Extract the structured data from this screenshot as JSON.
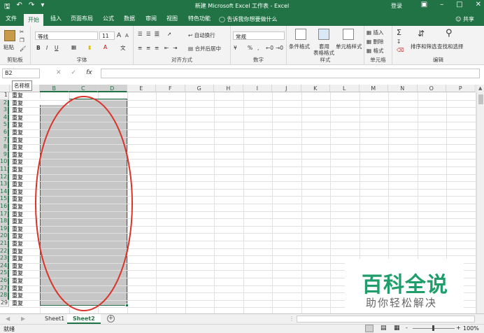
{
  "titlebar": {
    "title": "新建 Microsoft Excel 工作表 - Excel",
    "login": "登录",
    "qat": [
      "save-icon",
      "undo-icon",
      "redo-icon",
      "customize-icon"
    ]
  },
  "tabs": [
    "文件",
    "开始",
    "插入",
    "页面布局",
    "公式",
    "数据",
    "审阅",
    "视图",
    "特色功能"
  ],
  "tell_me": "告诉我你想要做什么",
  "share": "共享",
  "ribbon": {
    "clipboard": {
      "paste": "粘贴",
      "label": "剪贴板"
    },
    "font": {
      "name": "等线",
      "size": "11",
      "bold": "B",
      "italic": "I",
      "underline": "U",
      "grow": "A",
      "shrink": "A",
      "label": "字体"
    },
    "alignment": {
      "wrap": "自动换行",
      "merge": "合并后居中",
      "label": "对齐方式"
    },
    "number": {
      "format": "常规",
      "percent": "%",
      "comma": ",",
      "label": "数字"
    },
    "styles": {
      "conditional": "条件格式",
      "table_1": "套用",
      "table_2": "表格格式",
      "cell_styles": "单元格样式",
      "label": "样式"
    },
    "cells": {
      "insert": "插入",
      "delete": "删除",
      "format": "格式",
      "label": "单元格"
    },
    "editing": {
      "sum": "Σ",
      "sort": "排序和筛选",
      "find": "查找和选择",
      "label": "编辑"
    }
  },
  "formula_bar": {
    "name_box": "B2",
    "fx": "fx",
    "tooltip": "名称框"
  },
  "columns": [
    "A",
    "B",
    "C",
    "D",
    "E",
    "F",
    "G",
    "H",
    "I",
    "J",
    "K",
    "L",
    "M",
    "N",
    "O",
    "P"
  ],
  "selected_columns": [
    "B",
    "C",
    "D"
  ],
  "rows": [
    "1",
    "2",
    "3",
    "4",
    "5",
    "6",
    "7",
    "8",
    "9",
    "10",
    "11",
    "12",
    "13",
    "14",
    "15",
    "16",
    "17",
    "18",
    "19",
    "20",
    "21",
    "22",
    "23",
    "24",
    "25",
    "26",
    "27",
    "28",
    "29"
  ],
  "column_a_values": [
    "重复",
    "重复",
    "重复",
    "重复",
    "重复",
    "重复",
    "重复",
    "重复",
    "重复",
    "重复",
    "重复",
    "重复",
    "重复",
    "重复",
    "重复",
    "重复",
    "重复",
    "重复",
    "重复",
    "重复",
    "重复",
    "重复",
    "重复",
    "重复",
    "重复",
    "重复",
    "重复",
    "重复",
    "重复"
  ],
  "sheets": [
    "Sheet1",
    "Sheet2"
  ],
  "active_sheet": "Sheet2",
  "status": {
    "ready": "就绪",
    "zoom": "100%",
    "minus": "-",
    "plus": "+"
  },
  "watermark": {
    "title": "百科全说",
    "subtitle": "助你轻松解决"
  },
  "colors": {
    "excel_green": "#217346",
    "annotation_red": "#d9342b",
    "watermark_green": "#1f9d6a"
  }
}
